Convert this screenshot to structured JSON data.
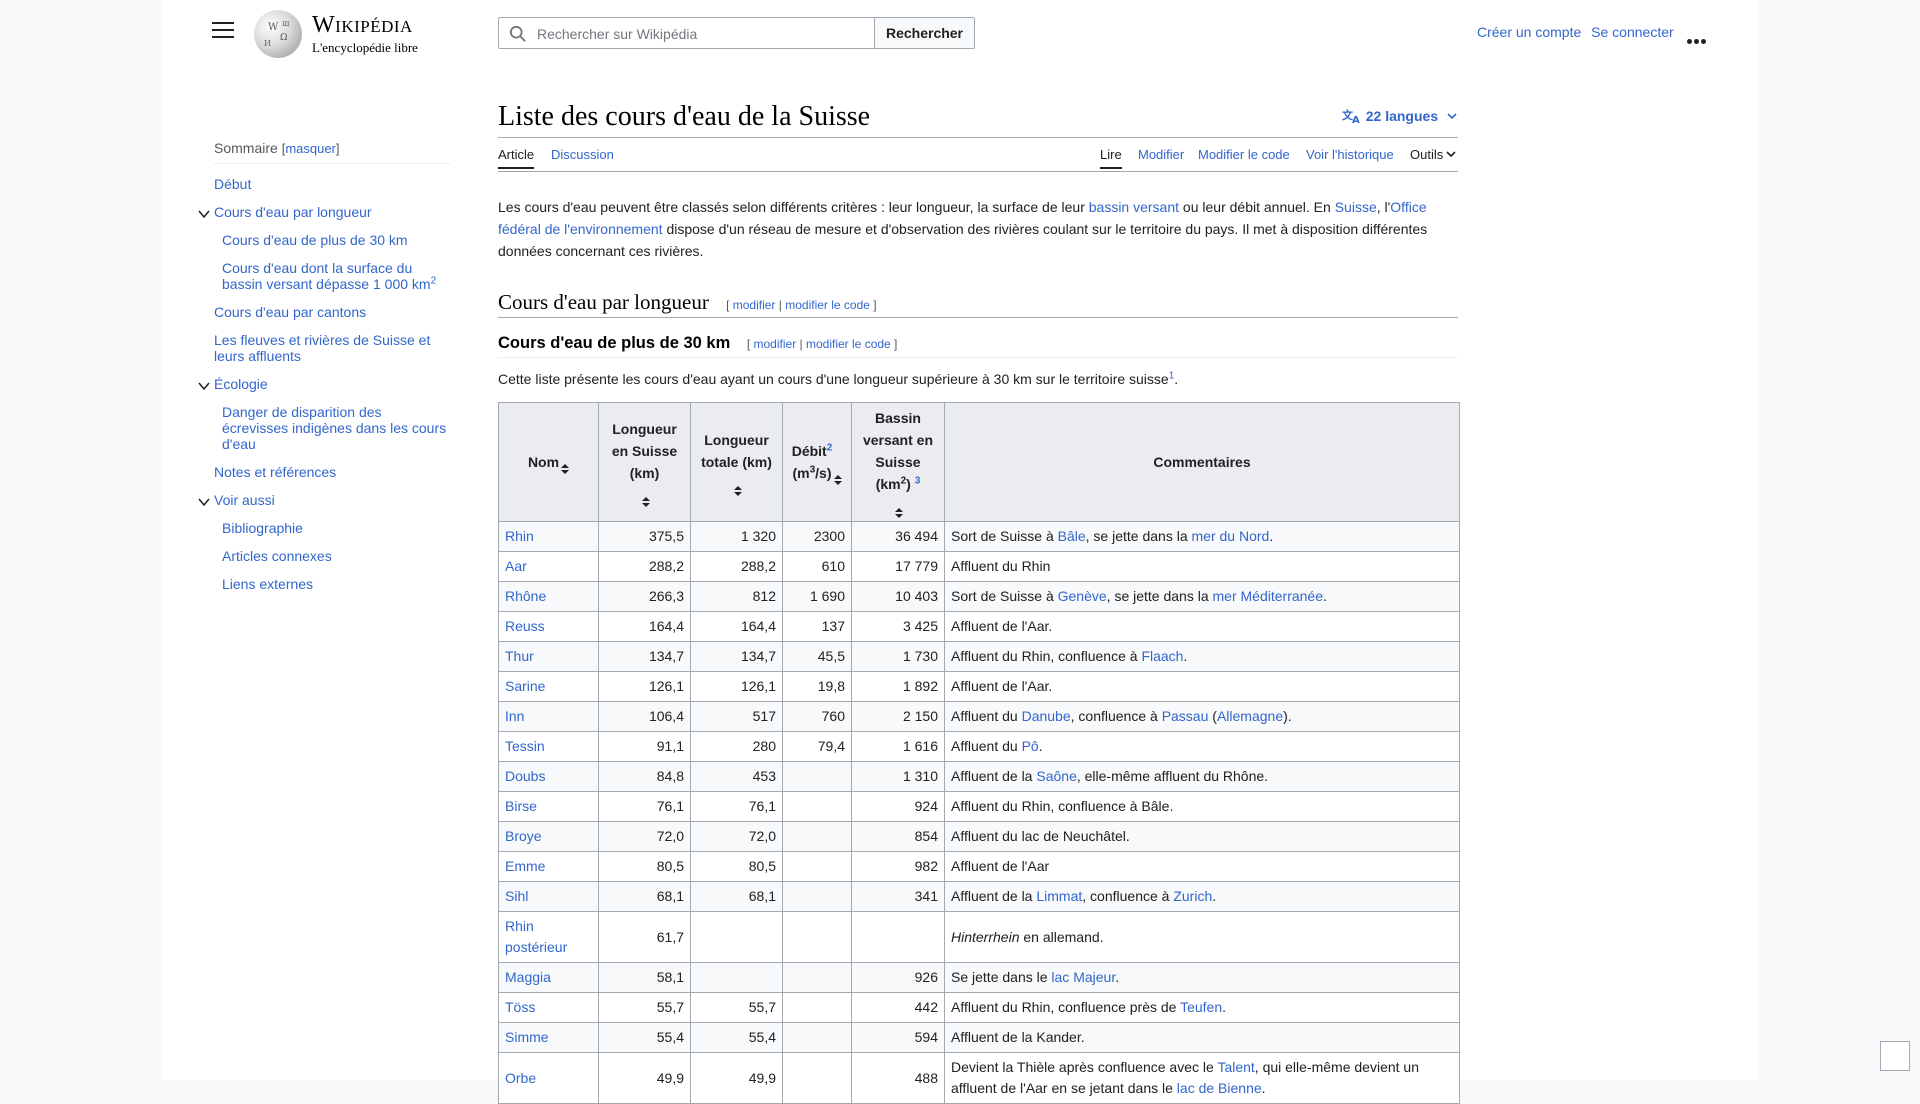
{
  "header": {
    "logo_title": "Wikipédia",
    "logo_tagline": "L'encyclopédie libre",
    "search_placeholder": "Rechercher sur Wikipédia",
    "search_button": "Rechercher",
    "create_account": "Créer un compte",
    "login": "Se connecter"
  },
  "toc": {
    "title": "Sommaire",
    "hide": "masquer",
    "items": [
      {
        "label": "Début",
        "level": 1
      },
      {
        "label": "Cours d'eau par longueur",
        "level": 1,
        "toggle": true
      },
      {
        "label": "Cours d'eau de plus de 30 km",
        "level": 2
      },
      {
        "label": "Cours d'eau dont la surface du bassin versant dépasse 1 000 km",
        "sup": "2",
        "level": 2
      },
      {
        "label": "Cours d'eau par cantons",
        "level": 1
      },
      {
        "label": "Les fleuves et rivières de Suisse et leurs affluents",
        "level": 1
      },
      {
        "label": "Écologie",
        "level": 1,
        "toggle": true
      },
      {
        "label": "Danger de disparition des écrevisses indigènes dans les cours d'eau",
        "level": 2
      },
      {
        "label": "Notes et références",
        "level": 1
      },
      {
        "label": "Voir aussi",
        "level": 1,
        "toggle": true
      },
      {
        "label": "Bibliographie",
        "level": 2
      },
      {
        "label": "Articles connexes",
        "level": 2
      },
      {
        "label": "Liens externes",
        "level": 2
      }
    ]
  },
  "article": {
    "title": "Liste des cours d'eau de la Suisse",
    "languages": "22 langues",
    "tabs_left": [
      "Article",
      "Discussion"
    ],
    "tabs_right": [
      "Lire",
      "Modifier",
      "Modifier le code",
      "Voir l'historique",
      "Outils"
    ],
    "intro": [
      {
        "t": "Les cours d'eau peuvent être classés selon différents critères : leur longueur, la surface de leur "
      },
      {
        "t": "bassin versant",
        "link": true
      },
      {
        "t": " ou leur débit annuel. En "
      },
      {
        "t": "Suisse",
        "link": true
      },
      {
        "t": ", l'"
      },
      {
        "t": "Office fédéral de l'environnement",
        "link": true
      },
      {
        "t": " dispose d'un réseau de mesure et d'observation des rivières coulant sur le territoire du pays. Il met à disposition différentes données concernant ces rivières."
      }
    ],
    "h2": "Cours d'eau par longueur",
    "h3": "Cours d'eau de plus de 30 km",
    "edit": "modifier",
    "edit_code": "modifier le code",
    "list_intro": "Cette liste présente les cours d'eau ayant un cours d'une longueur supérieure à 30 km sur le territoire suisse",
    "list_intro_ref": "1"
  },
  "table": {
    "headers": [
      "Nom",
      "Longueur en Suisse (km)",
      "Longueur totale (km)",
      "Débit",
      "Bassin versant en Suisse (km",
      "Commentaires"
    ],
    "debit_ref": "2",
    "debit_unit": "(m3/s)",
    "bassin_ref": "3",
    "rows": [
      {
        "nom": "Rhin",
        "ls": "375,5",
        "lt": "1 320",
        "debit": "2300",
        "bassin": "36 494",
        "c": [
          {
            "t": "Sort de Suisse à "
          },
          {
            "t": "Bâle",
            "link": true
          },
          {
            "t": ", se jette dans la "
          },
          {
            "t": "mer du Nord",
            "link": true
          },
          {
            "t": "."
          }
        ]
      },
      {
        "nom": "Aar",
        "ls": "288,2",
        "lt": "288,2",
        "debit": "610",
        "bassin": "17 779",
        "c": [
          {
            "t": "Affluent du Rhin"
          }
        ]
      },
      {
        "nom": "Rhône",
        "ls": "266,3",
        "lt": "812",
        "debit": "1 690",
        "bassin": "10 403",
        "c": [
          {
            "t": "Sort de Suisse à "
          },
          {
            "t": "Genève",
            "link": true
          },
          {
            "t": ", se jette dans la "
          },
          {
            "t": "mer Méditerranée",
            "link": true
          },
          {
            "t": "."
          }
        ]
      },
      {
        "nom": "Reuss",
        "ls": "164,4",
        "lt": "164,4",
        "debit": "137",
        "bassin": "3 425",
        "c": [
          {
            "t": "Affluent de l'Aar."
          }
        ]
      },
      {
        "nom": "Thur",
        "ls": "134,7",
        "lt": "134,7",
        "debit": "45,5",
        "bassin": "1 730",
        "c": [
          {
            "t": "Affluent du Rhin, confluence à "
          },
          {
            "t": "Flaach",
            "link": true
          },
          {
            "t": "."
          }
        ]
      },
      {
        "nom": "Sarine",
        "ls": "126,1",
        "lt": "126,1",
        "debit": "19,8",
        "bassin": "1 892",
        "c": [
          {
            "t": "Affluent de l'Aar."
          }
        ]
      },
      {
        "nom": "Inn",
        "ls": "106,4",
        "lt": "517",
        "debit": "760",
        "bassin": "2 150",
        "c": [
          {
            "t": "Affluent du "
          },
          {
            "t": "Danube",
            "link": true
          },
          {
            "t": ", confluence à "
          },
          {
            "t": "Passau",
            "link": true
          },
          {
            "t": " ("
          },
          {
            "t": "Allemagne",
            "link": true
          },
          {
            "t": ")."
          }
        ]
      },
      {
        "nom": "Tessin",
        "ls": "91,1",
        "lt": "280",
        "debit": "79,4",
        "bassin": "1 616",
        "c": [
          {
            "t": "Affluent du "
          },
          {
            "t": "Pô",
            "link": true
          },
          {
            "t": "."
          }
        ]
      },
      {
        "nom": "Doubs",
        "ls": "84,8",
        "lt": "453",
        "debit": "",
        "bassin": "1 310",
        "c": [
          {
            "t": "Affluent de la "
          },
          {
            "t": "Saône",
            "link": true
          },
          {
            "t": ", elle-même affluent du Rhône."
          }
        ]
      },
      {
        "nom": "Birse",
        "ls": "76,1",
        "lt": "76,1",
        "debit": "",
        "bassin": "924",
        "c": [
          {
            "t": "Affluent du Rhin, confluence à Bâle."
          }
        ]
      },
      {
        "nom": "Broye",
        "ls": "72,0",
        "lt": "72,0",
        "debit": "",
        "bassin": "854",
        "c": [
          {
            "t": "Affluent du lac de Neuchâtel."
          }
        ]
      },
      {
        "nom": "Emme",
        "ls": "80,5",
        "lt": "80,5",
        "debit": "",
        "bassin": "982",
        "c": [
          {
            "t": "Affluent de l'Aar"
          }
        ]
      },
      {
        "nom": "Sihl",
        "ls": "68,1",
        "lt": "68,1",
        "debit": "",
        "bassin": "341",
        "c": [
          {
            "t": "Affluent de la "
          },
          {
            "t": "Limmat",
            "link": true
          },
          {
            "t": ", confluence à "
          },
          {
            "t": "Zurich",
            "link": true
          },
          {
            "t": "."
          }
        ]
      },
      {
        "nom": "Rhin postérieur",
        "ls": "61,7",
        "lt": "",
        "debit": "",
        "bassin": "",
        "c": [
          {
            "t": "Hinterrhein",
            "italic": true
          },
          {
            "t": " en allemand."
          }
        ]
      },
      {
        "nom": "Maggia",
        "ls": "58,1",
        "lt": "",
        "debit": "",
        "bassin": "926",
        "c": [
          {
            "t": "Se jette dans le "
          },
          {
            "t": "lac Majeur",
            "link": true
          },
          {
            "t": "."
          }
        ]
      },
      {
        "nom": "Töss",
        "ls": "55,7",
        "lt": "55,7",
        "debit": "",
        "bassin": "442",
        "c": [
          {
            "t": "Affluent du Rhin, confluence près de "
          },
          {
            "t": "Teufen",
            "link": true
          },
          {
            "t": "."
          }
        ]
      },
      {
        "nom": "Simme",
        "ls": "55,4",
        "lt": "55,4",
        "debit": "",
        "bassin": "594",
        "c": [
          {
            "t": "Affluent de la Kander."
          }
        ]
      },
      {
        "nom": "Orbe",
        "ls": "49,9",
        "lt": "49,9",
        "debit": "",
        "bassin": "488",
        "c": [
          {
            "t": "Devient la Thièle après confluence avec le "
          },
          {
            "t": "Talent",
            "link": true
          },
          {
            "t": ", qui elle-même devient un affluent de l'Aar en se jetant dans le "
          },
          {
            "t": "lac de Bienne",
            "link": true
          },
          {
            "t": "."
          }
        ]
      }
    ]
  }
}
